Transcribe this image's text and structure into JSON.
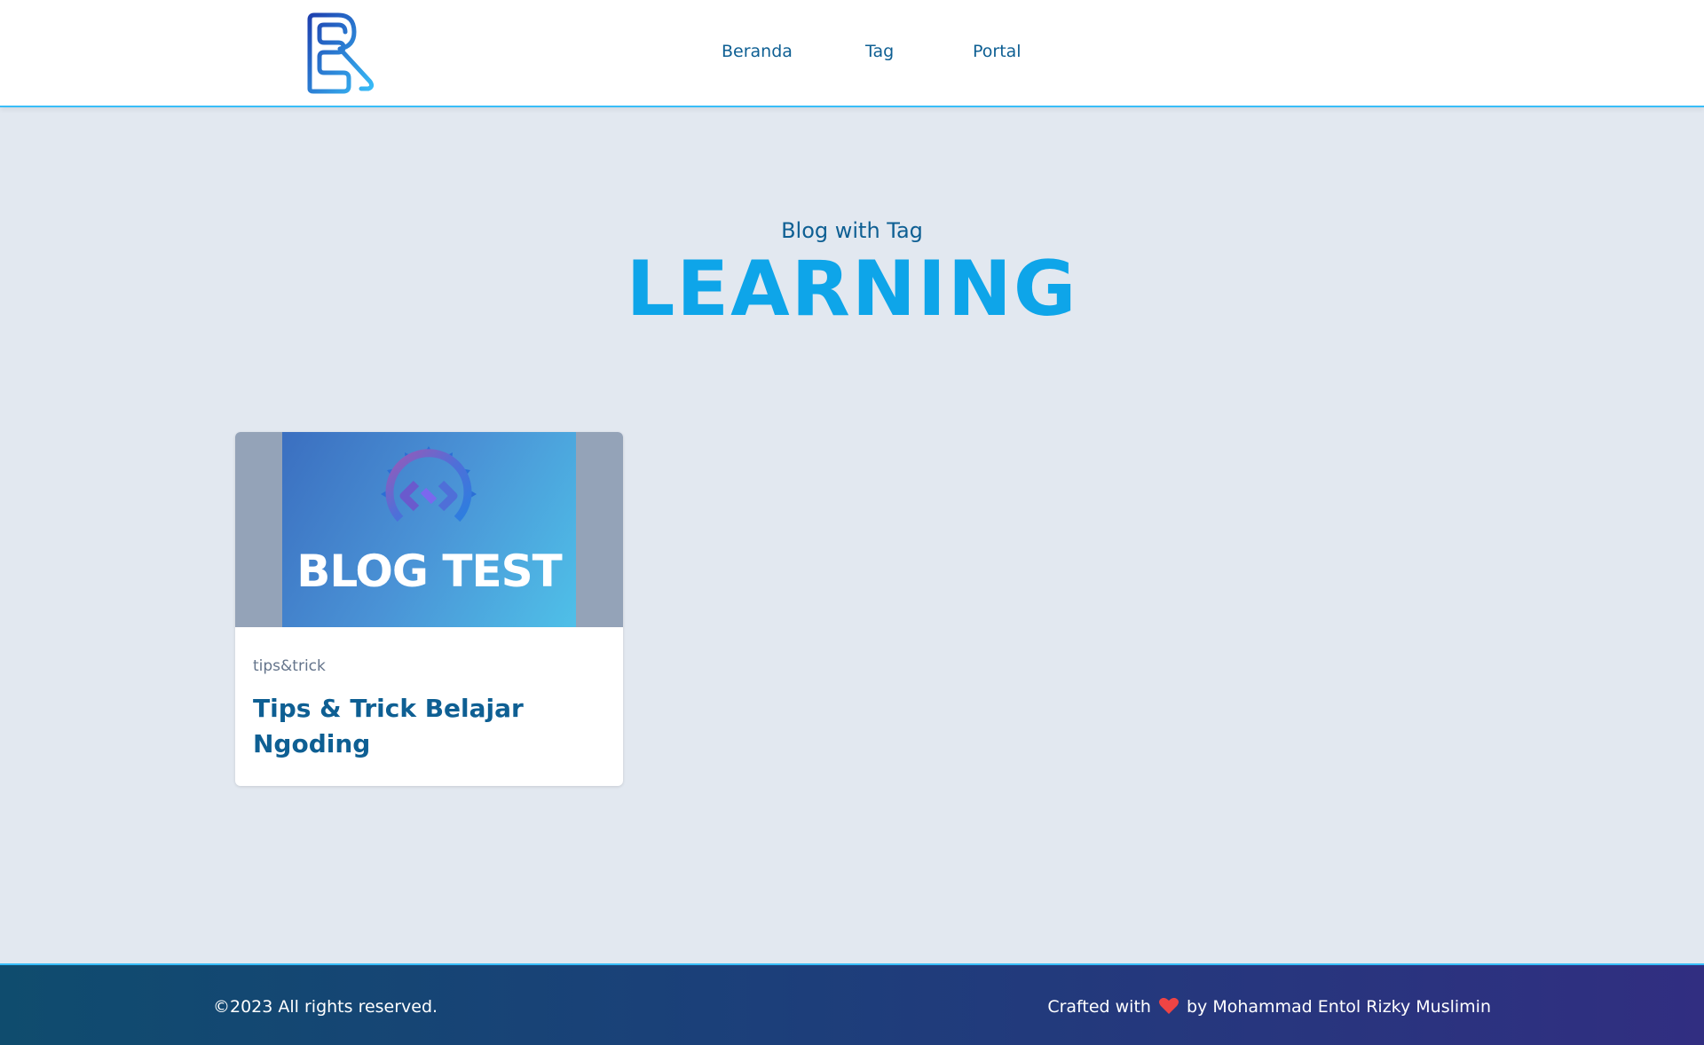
{
  "header": {
    "nav": [
      {
        "label": "Beranda"
      },
      {
        "label": "Tag"
      },
      {
        "label": "Portal"
      }
    ]
  },
  "hero": {
    "subtitle": "Blog with Tag",
    "title": "LEARNING"
  },
  "posts": [
    {
      "image_text": "BLOG TEST",
      "tag": "tips&trick",
      "title": "Tips & Trick Belajar Ngoding"
    }
  ],
  "footer": {
    "copyright": "©2023 All rights reserved.",
    "crafted_prefix": "Crafted with",
    "crafted_suffix": "by Mohammad Entol Rizky Muslimin"
  },
  "colors": {
    "accent": "#0ea5e9",
    "link": "#0e5f93",
    "heart": "#ef4444"
  }
}
